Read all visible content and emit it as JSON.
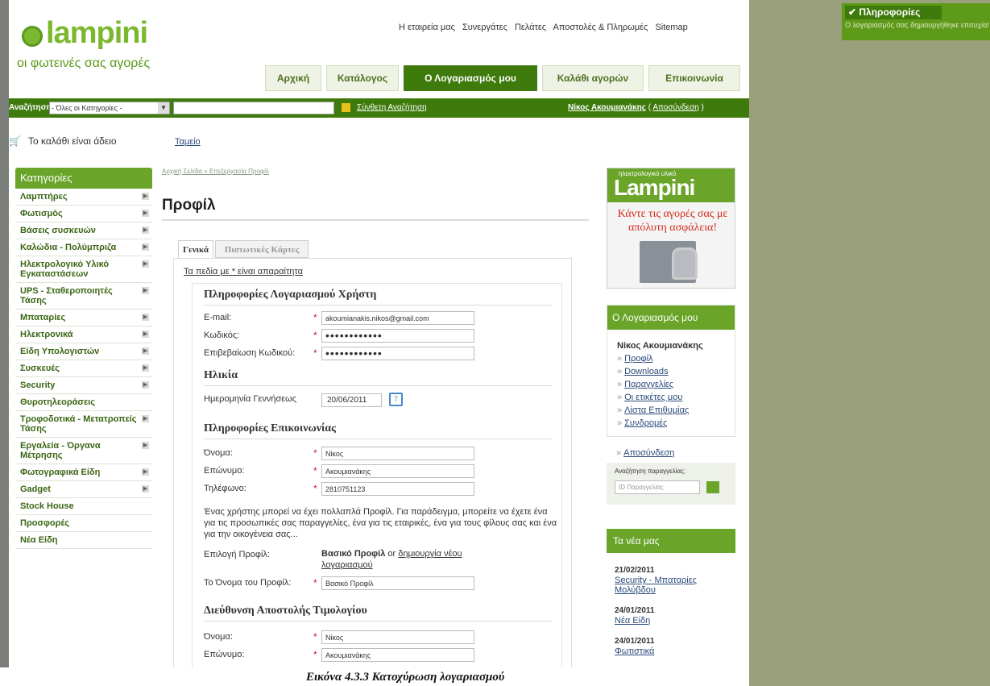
{
  "notification": {
    "title": "Πληροφορίες",
    "text": "Ο λογαριασμός σας δημιουργήθηκε επιτυχία!"
  },
  "caption": "Εικόνα 4.3.3 Κατοχύρωση λογαριασμού",
  "brand": {
    "logo": "lampini",
    "slogan": "οι φωτεινές σας αγορές"
  },
  "top_links": [
    "Η εταιρεία μας",
    "Συνεργάτες",
    "Πελάτες",
    "Αποστολές & Πληρωμές",
    "Sitemap"
  ],
  "nav_tabs": [
    {
      "label": "Αρχική",
      "active": false
    },
    {
      "label": "Κατάλογος",
      "active": false
    },
    {
      "label": "Ο Λογαριασμός μου",
      "active": true
    },
    {
      "label": "Καλάθι αγορών",
      "active": false
    },
    {
      "label": "Επικοινωνία",
      "active": false
    }
  ],
  "search_bar": {
    "label": "Αναζήτηση:",
    "category": "- Όλες οι Κατηγορίες -",
    "value": "",
    "advanced": "Σύνθετη Αναζήτηση",
    "user": "Νίκος Ακουμιανάκης",
    "logout": "Αποσύνδεση"
  },
  "cart": {
    "text": "Το καλάθι είναι άδειο",
    "register": "Ταμείο"
  },
  "categories": {
    "title": "Κατηγορίες",
    "items": [
      {
        "label": "Λαμπτήρες",
        "arrow": true
      },
      {
        "label": "Φωτισμός",
        "arrow": true
      },
      {
        "label": "Βάσεις συσκευών",
        "arrow": true
      },
      {
        "label": "Καλώδια - Πολύμπριζα",
        "arrow": true
      },
      {
        "label": "Ηλεκτρολογικό Υλικό Εγκαταστάσεων",
        "arrow": true
      },
      {
        "label": "UPS - Σταθεροποιητές Τάσης",
        "arrow": true
      },
      {
        "label": "Μπαταρίες",
        "arrow": true
      },
      {
        "label": "Ηλεκτρονικά",
        "arrow": true
      },
      {
        "label": "Είδη Υπολογιστών",
        "arrow": true
      },
      {
        "label": "Συσκευές",
        "arrow": true
      },
      {
        "label": "Security",
        "arrow": true
      },
      {
        "label": "Θυροτηλεοράσεις",
        "arrow": false
      },
      {
        "label": "Τροφοδοτικά - Μετατροπείς Τάσης",
        "arrow": true
      },
      {
        "label": "Εργαλεία - Όργανα Μέτρησης",
        "arrow": true
      },
      {
        "label": "Φωτογραφικά Είδη",
        "arrow": true
      },
      {
        "label": "Gadget",
        "arrow": true
      },
      {
        "label": "Stock House",
        "arrow": false
      },
      {
        "label": "Προσφορές",
        "arrow": false
      },
      {
        "label": "Νέα Είδη",
        "arrow": false
      }
    ]
  },
  "breadcrumb": {
    "home": "Αρχική Σελίδα",
    "current": "Επεξεργασία Προφίλ"
  },
  "page_title": "Προφίλ",
  "profile_tabs": [
    {
      "label": "Γενικά",
      "active": true
    },
    {
      "label": "Πιστωτικές Κάρτες",
      "active": false
    }
  ],
  "required_note": "Τα πεδία με * είναι απαραίτητα",
  "form": {
    "account_section": "Πληροφορίες Λογαριασμού Χρήστη",
    "email_label": "E-mail:",
    "email_value": "akoumianakis.nikos@gmail.com",
    "password_label": "Κωδικός:",
    "password_value": "••••••••••••",
    "confirm_label": "Επιβεβαίωση Κωδικού:",
    "confirm_value": "••••••••••••",
    "age_section": "Ηλικία",
    "dob_label": "Ημερομηνία Γεννήσεως",
    "dob_value": "20/06/2011",
    "contact_section": "Πληροφορίες Επικοινωνίας",
    "first_label": "Όνομα:",
    "first_value": "Νίκος",
    "last_label": "Επώνυμο:",
    "last_value": "Ακουμιανάκης",
    "phone_label": "Τηλέφωνο:",
    "phone_value": "2810751123",
    "profile_note": "Ένας χρήστης μπορεί να έχει πολλαπλά Προφίλ. Για παράδειγμα, μπορείτε να έχετε ένα για τις προσωπικές σας παραγγελίες, ένα για τις εταιρικές, ένα για τους φίλους σας και ένα για την οικογένεια σας...",
    "select_profile_label": "Επιλογή Προφίλ:",
    "select_profile_value": "Βασικό Προφίλ",
    "select_profile_or": "or",
    "new_account_link": "δημιουργία νέου λογαριασμού",
    "profile_name_label": "Το Όνομα του Προφίλ:",
    "profile_name_value": "Βασικό Προφίλ",
    "billing_section": "Διεύθυνση Αποστολής Τιμολογίου",
    "billing_first_label": "Όνομα:",
    "billing_first_value": "Νίκος",
    "billing_last_label": "Επώνυμο:",
    "billing_last_value": "Ακουμιανάκης"
  },
  "ad": {
    "brand": "ηλεκτρολογικό υλικό",
    "logo": "Lampini",
    "text": "Κάντε τις αγορές σας με απόλυτη ασφάλεια!"
  },
  "account_box": {
    "title": "Ο Λογαριασμός μου",
    "user": "Νίκος Ακουμιανάκης",
    "links": [
      "Προφίλ",
      "Downloads",
      "Παραγγελίες",
      "Οι ετικέτες μου",
      "Λίστα Επιθυμίας",
      "Συνδρομές",
      "Αποσύνδεση"
    ],
    "order_search_label": "Αναζήτηση παραγγελίας:",
    "order_search_placeholder": "ID Παραγγελίας"
  },
  "news": {
    "title": "Τα νέα μας",
    "items": [
      {
        "date": "21/02/2011",
        "title": "Security - Μπαταρίες Μολύβδου"
      },
      {
        "date": "24/01/2011",
        "title": "Νέα Είδη"
      },
      {
        "date": "24/01/2011",
        "title": "Φωτιστικά"
      }
    ]
  }
}
